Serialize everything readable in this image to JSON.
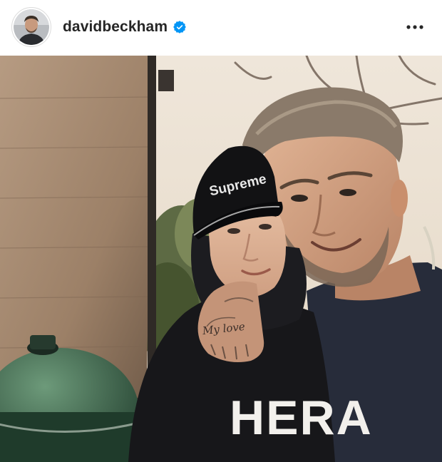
{
  "post": {
    "username": "davidbeckham",
    "verified": true,
    "icons": {
      "verified": "verified-badge-icon",
      "more": "more-options-icon"
    },
    "colors": {
      "username": "#262626",
      "verified": "#0095f6",
      "divider": "#efefef"
    }
  },
  "photo": {
    "shirt_text": "HERA",
    "cap_text": "Supreme",
    "tattoo_text": "My love"
  }
}
